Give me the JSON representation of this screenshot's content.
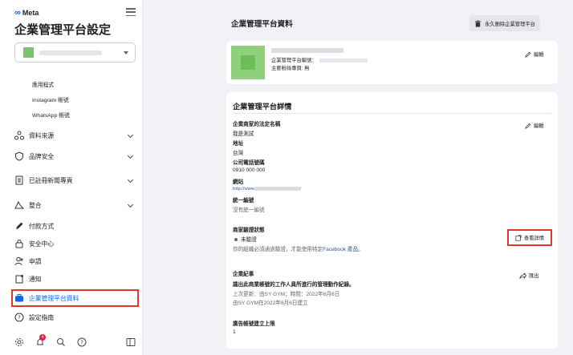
{
  "sidebar": {
    "brand": "Meta",
    "title": "企業管理平台設定",
    "sub_links": [
      "應用程式",
      "Instagram 帳號",
      "WhatsApp 帳號"
    ],
    "nav_items": [
      {
        "label": "資料來源",
        "icon": "data-sources-icon",
        "has_chevron": true
      },
      {
        "label": "品牌安全",
        "icon": "shield-icon",
        "has_chevron": true
      },
      {
        "label": "已註冊新聞專頁",
        "icon": "news-page-icon",
        "has_chevron": true
      },
      {
        "label": "整合",
        "icon": "integrations-icon",
        "has_chevron": true
      },
      {
        "label": "付款方式",
        "icon": "pencil-icon",
        "has_chevron": false
      },
      {
        "label": "安全中心",
        "icon": "lock-icon",
        "has_chevron": false
      },
      {
        "label": "申請",
        "icon": "person-add-icon",
        "has_chevron": false
      },
      {
        "label": "通知",
        "icon": "notification-doc-icon",
        "has_chevron": false
      },
      {
        "label": "企業管理平台資料",
        "icon": "briefcase-icon",
        "has_chevron": false,
        "active": true
      },
      {
        "label": "設定指南",
        "icon": "help-circle-icon",
        "has_chevron": false
      }
    ],
    "bottom_icons": [
      "gear-icon",
      "bell-icon",
      "search-icon",
      "help-icon",
      "panel-icon"
    ],
    "notification_count": "4"
  },
  "main": {
    "title": "企業管理平台資料",
    "delete_button": "永久刪除企業管理平台",
    "profile": {
      "id_label": "企業管理平台編號：",
      "primary_page": "主要粉絲專頁: 無",
      "edit_label": "編輯"
    },
    "details": {
      "title": "企業管理平台詳情",
      "edit_label": "編輯",
      "legal_name_label": "企業商家的法定名稱",
      "legal_name_value": "我是測試",
      "address_label": "地址",
      "address_value": "台灣",
      "phone_label": "公司電話號碼",
      "phone_value": "0910 000 000",
      "website_label": "網站",
      "website_value_prefix": "http://www.",
      "website_value_suffix": "/",
      "tax_id_label": "統一編號",
      "tax_id_value": "沒有統一編號",
      "verification_label": "商家驗證狀態",
      "verification_status": "未驗證",
      "verification_note_prefix": "你的組織必須通過驗證，才能使用特定",
      "verification_note_link": "Facebook 產品",
      "verification_note_suffix": "。",
      "view_details_label": "查看詳情",
      "records_label": "企業紀事",
      "records_desc": "識出此商業帳號的工作人員所進行的管理動作紀錄。",
      "last_update": "上次更新：由SY GYM；時間：2022年6月6日",
      "created": "由SY GYM在2022年6月6日建立",
      "export_label": "匯出",
      "ad_limit_label": "廣告帳號建立上限",
      "ad_limit_value": "1"
    }
  }
}
